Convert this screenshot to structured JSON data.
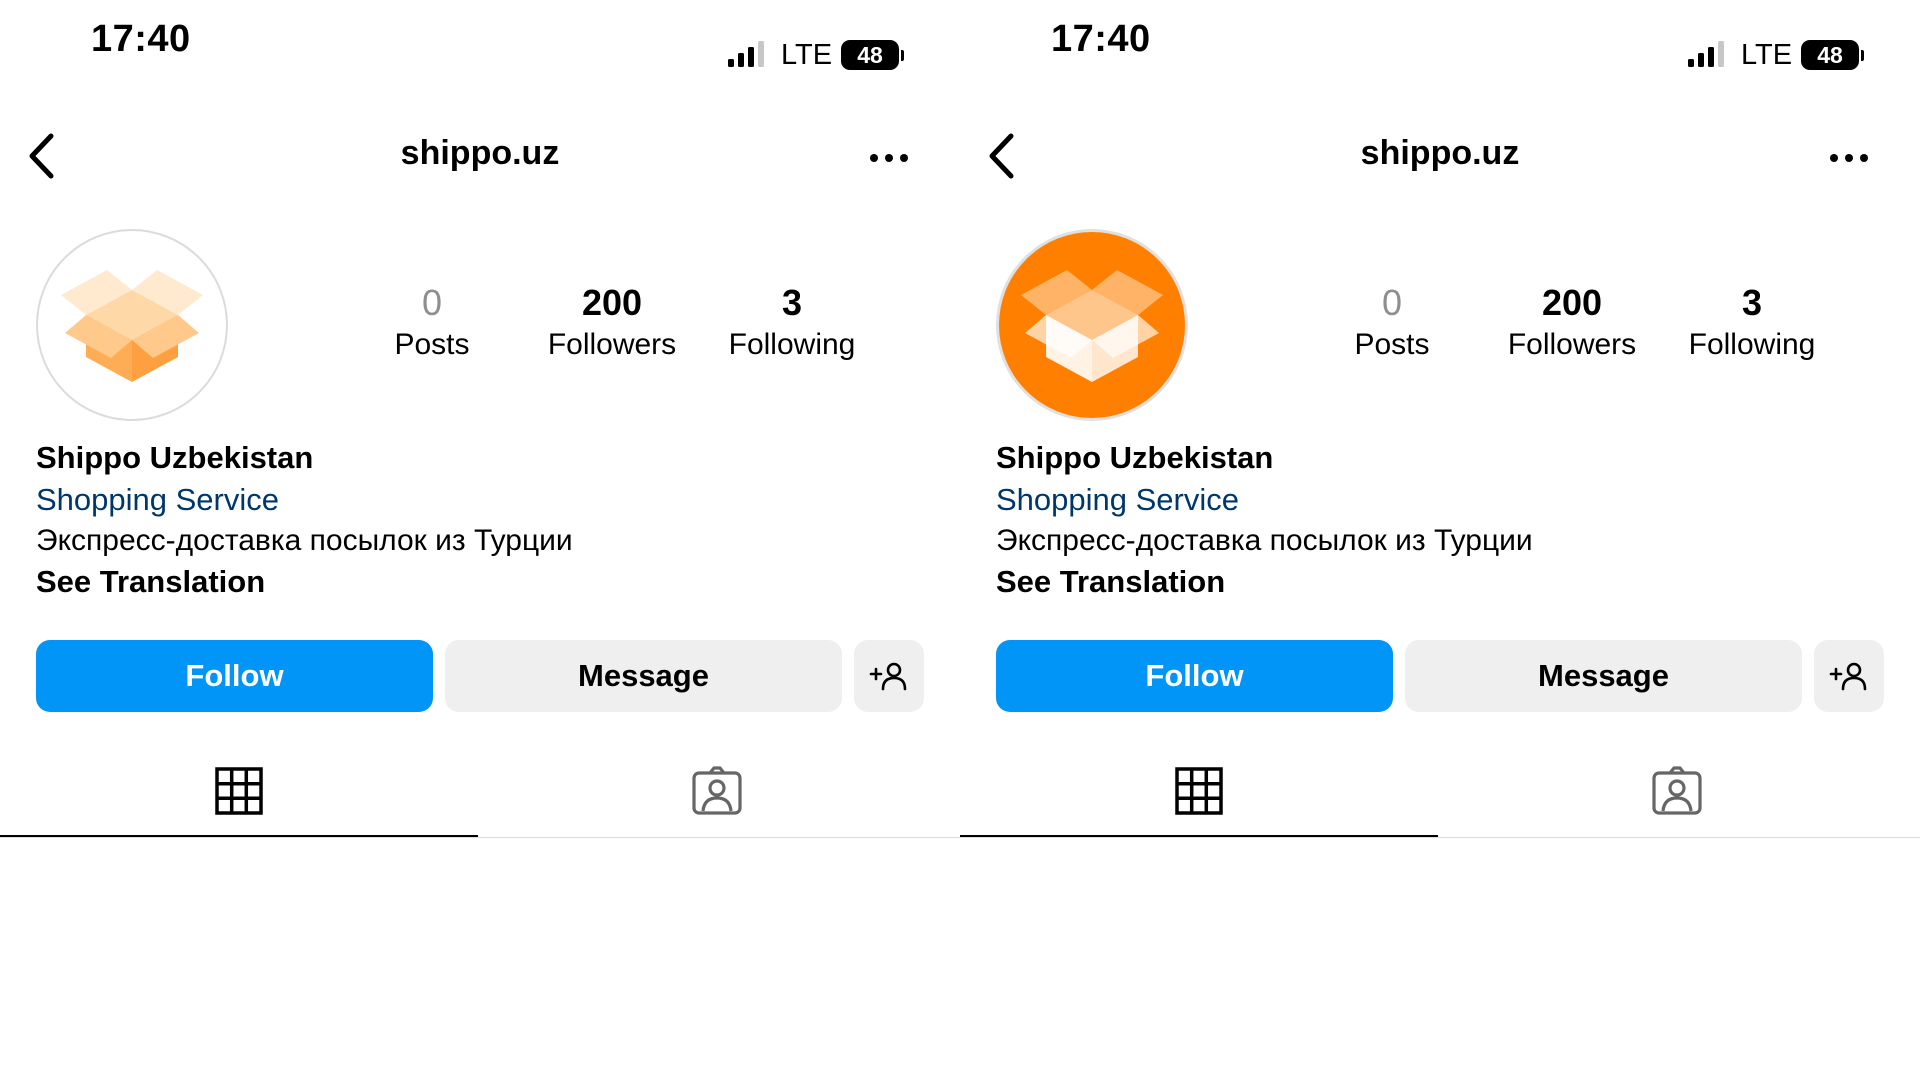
{
  "status_bar": {
    "time": "17:40",
    "network": "LTE",
    "battery": "48"
  },
  "header": {
    "username": "shippo.uz",
    "back_icon": "chevron-left-icon",
    "more_icon": "ellipsis-horizontal-icon"
  },
  "profile": {
    "avatar_icon": "box-logo-icon",
    "posts_count": "0",
    "posts_label": "Posts",
    "followers_count": "200",
    "followers_label": "Followers",
    "following_count": "3",
    "following_label": "Following",
    "display_name": "Shippo Uzbekistan",
    "category": "Shopping Service",
    "bio": "Экспресс-доставка посылок из Турции",
    "see_translation": "See Translation"
  },
  "actions": {
    "follow_label": "Follow",
    "message_label": "Message",
    "add_user_icon": "add-person-icon"
  },
  "tabs": {
    "grid_icon": "grid-icon",
    "tagged_icon": "tagged-person-icon",
    "active": "grid"
  },
  "colors": {
    "follow_button": "#0095f6",
    "secondary_button": "#efefef",
    "category_link": "#00376b",
    "avatar_orange": "#ff8000",
    "avatar_white": "#ffffff"
  }
}
